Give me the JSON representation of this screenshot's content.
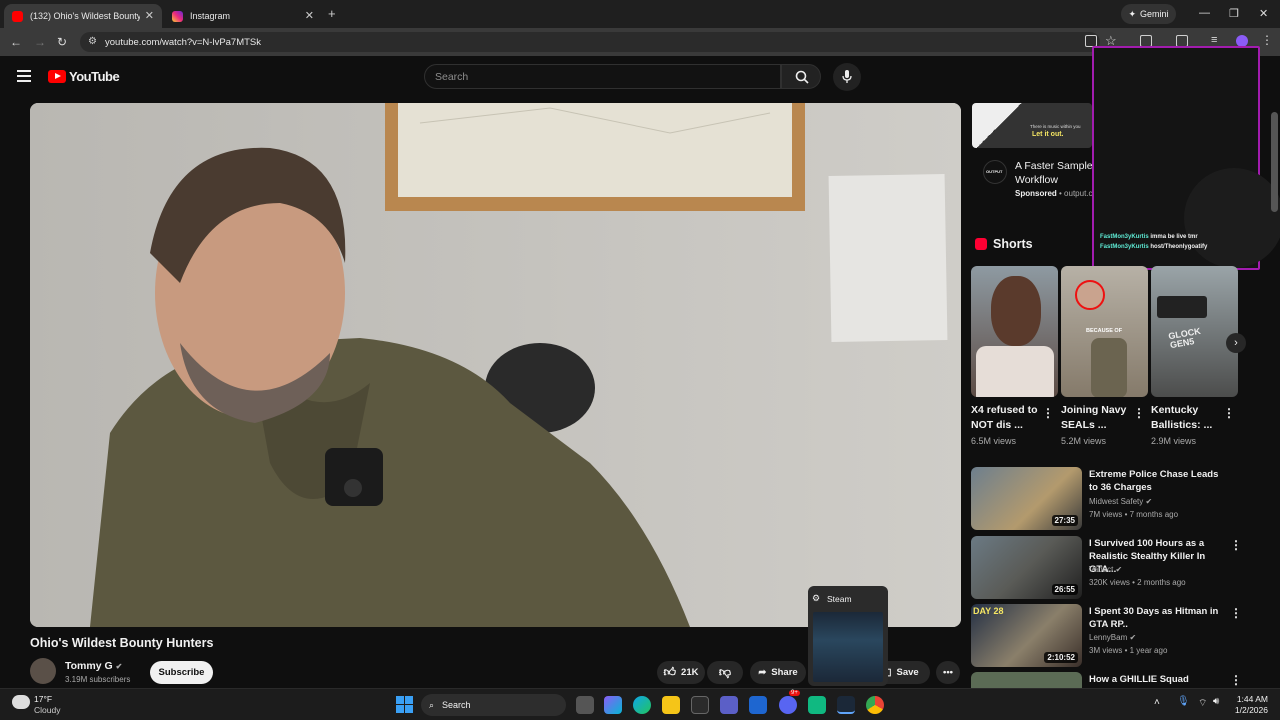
{
  "browser": {
    "tabs": [
      {
        "label": "(132) Ohio's Wildest Bounty Hu"
      },
      {
        "label": "Instagram"
      }
    ],
    "gemini_label": "Gemini",
    "url": "youtube.com/watch?v=N-lvPa7MTSk"
  },
  "youtube": {
    "logo_text": "YouTube",
    "search_placeholder": "Search",
    "video": {
      "title": "Ohio's Wildest Bounty Hunters",
      "channel": "Tommy G",
      "subscribers": "3.19M subscribers",
      "subscribe_label": "Subscribe",
      "likes": "21K",
      "share_label": "Share",
      "save_label": "Save"
    },
    "ad": {
      "thumb_caption_top": "There is music within you",
      "thumb_caption": "Let it out.",
      "logo_text": "OUTPUT",
      "title": "A Faster Sample Workflow",
      "sponsored": "Sponsored",
      "domain": "output.c"
    },
    "stream_overlay": {
      "chat": [
        {
          "user": "FastMon3yKurtis",
          "message": "imma be live tmr"
        },
        {
          "user": "FastMon3yKurtis",
          "message": "host/Theonlygoatify"
        }
      ]
    },
    "shorts": {
      "heading": "Shorts",
      "items": [
        {
          "title": "X4 refused to NOT dis ...",
          "views": "6.5M views"
        },
        {
          "title": "Joining Navy SEALs ...",
          "views": "5.2M views",
          "overlay": "BECAUSE OF"
        },
        {
          "title": "Kentucky Ballistics: ...",
          "views": "2.9M views",
          "overlay": "GLOCK GEN5"
        }
      ]
    },
    "related": [
      {
        "title": "Extreme Police Chase Leads to 36 Charges",
        "channel": "Midwest Safety",
        "meta": "7M views • 7 months ago",
        "duration": "27:35"
      },
      {
        "title": "I Survived 100 Hours as a Realistic Stealthy Killer In GTA...",
        "channel": "Vadact",
        "meta": "320K views • 2 months ago",
        "duration": "26:55"
      },
      {
        "title": "I Spent 30 Days as Hitman in GTA RP..",
        "channel": "LennyBam",
        "meta": "3M views • 1 year ago",
        "duration": "2:10:52",
        "thumb_text": "DAY 28"
      },
      {
        "title": "How a GHILLIE Squad",
        "channel": "",
        "meta": "",
        "duration": ""
      }
    ]
  },
  "steam_popup": {
    "label": "Steam"
  },
  "taskbar": {
    "weather_temp": "17°F",
    "weather_desc": "Cloudy",
    "search_label": "Search",
    "badge": "9+",
    "time": "1:44 AM",
    "date": "1/2/2026"
  },
  "colors": {
    "accent_red": "#ff0000",
    "overlay_border": "#a21caf",
    "chat_user": "#5eead4"
  }
}
